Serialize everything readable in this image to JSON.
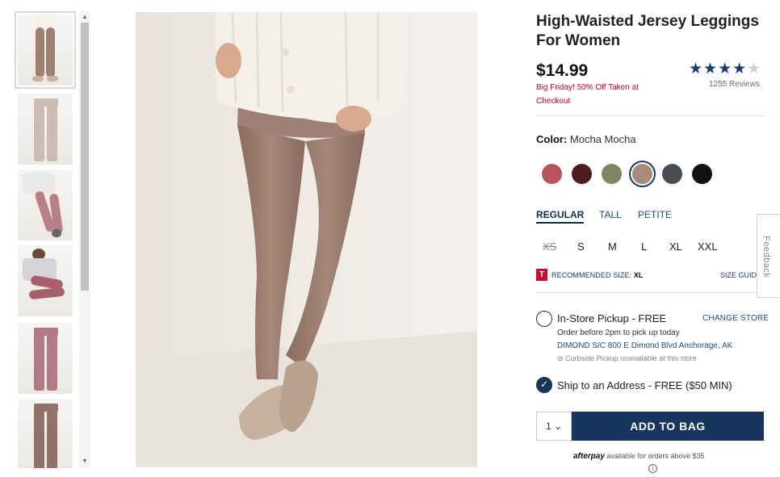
{
  "product": {
    "title": "High-Waisted Jersey Leggings For Women",
    "price": "$14.99",
    "promo": "Big Friday! 50% Off Taken at Checkout",
    "rating": 4,
    "rating_max": 5,
    "stars_text": "★★★★",
    "empty_star": "★",
    "reviews": "1255 Reviews"
  },
  "thumbnails": [
    {
      "label": "thumb-1-model-front",
      "selected": true
    },
    {
      "label": "thumb-2-flat-front",
      "selected": false
    },
    {
      "label": "thumb-3-model-side",
      "selected": false
    },
    {
      "label": "thumb-4-model-sweater",
      "selected": false
    },
    {
      "label": "thumb-5-flat-pink",
      "selected": false
    },
    {
      "label": "thumb-6-flat-mocha",
      "selected": false
    }
  ],
  "color": {
    "label": "Color:",
    "value": "Mocha Mocha",
    "swatches": [
      {
        "name": "rose",
        "hex": "#b9545a"
      },
      {
        "name": "burgundy",
        "hex": "#4d1d22"
      },
      {
        "name": "olive",
        "hex": "#7d8860"
      },
      {
        "name": "mocha",
        "hex": "#a88a7c",
        "selected": true
      },
      {
        "name": "charcoal",
        "hex": "#4a4c53"
      },
      {
        "name": "black",
        "hex": "#111111"
      }
    ]
  },
  "fits": [
    {
      "label": "REGULAR",
      "active": true
    },
    {
      "label": "TALL",
      "active": false
    },
    {
      "label": "PETITE",
      "active": false
    }
  ],
  "sizes": [
    {
      "label": "XS",
      "available": false
    },
    {
      "label": "S",
      "available": true
    },
    {
      "label": "M",
      "available": true
    },
    {
      "label": "L",
      "available": true
    },
    {
      "label": "XL",
      "available": true
    },
    {
      "label": "XXL",
      "available": true
    }
  ],
  "recommended": {
    "badge": "T",
    "label": "RECOMMENDED SIZE:",
    "size": "XL",
    "guide": "SIZE GUIDE"
  },
  "pickup": {
    "title": "In-Store Pickup - FREE",
    "change_store": "CHANGE STORE",
    "order_before": "Order before 2pm to pick up today",
    "store": "DIMOND S/C 800 E Dimond Blvd  Anchorage, AK",
    "curbside": "Curbside Pickup unavailable at this store",
    "curbside_icon": "⊘"
  },
  "ship": {
    "title": "Ship to an Address - FREE ($50 MIN)",
    "check": "✓"
  },
  "cart": {
    "qty": "1",
    "qty_arrow": "⌄",
    "add_label": "ADD TO BAG"
  },
  "afterpay": {
    "brand": "afterpay",
    "text": "available for orders above $35",
    "info": "i"
  },
  "feedback": "Feedback",
  "scroll": {
    "up": "▲",
    "down": "▼"
  }
}
